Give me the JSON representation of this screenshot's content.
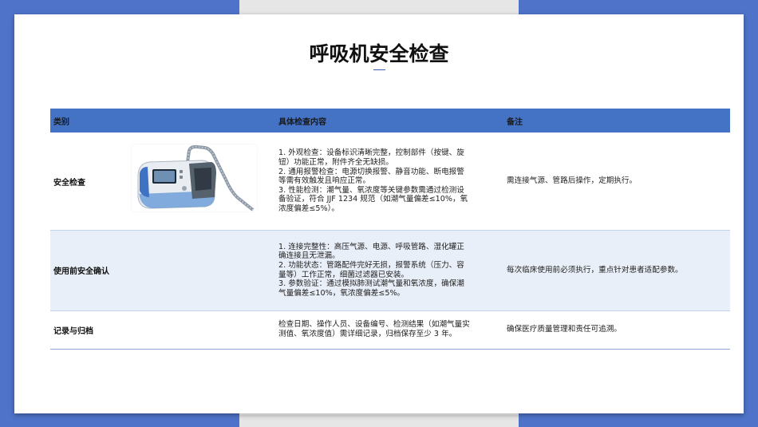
{
  "slide": {
    "title": "呼吸机安全检查"
  },
  "table": {
    "headers": [
      "类别",
      "具体检查内容",
      "备注"
    ],
    "rows": [
      {
        "category": "安全检查",
        "content": [
          "1. 外观检查：设备标识清晰完整，控制部件（按键、旋",
          "钮）功能正常，附件齐全无缺损。",
          "2. 通用报警检查：电源切换报警、静音功能、断电报警",
          "等需有效触发且响应正常。",
          "3. 性能检测：潮气量、氧浓度等关键参数需通过检测设",
          "备验证，符合 JJF 1234 规范（如潮气量偏差≤10%，氧",
          "浓度偏差≤5%）。"
        ],
        "note": "需连接气源、管路后操作，定期执行。"
      },
      {
        "category": "使用前安全确认",
        "content": [
          "1. 连接完整性：高压气源、电源、呼吸管路、湿化罐正",
          "确连接且无泄漏。",
          "2. 功能状态：管路配件完好无损，报警系统（压力、容",
          "量等）工作正常，细菌过滤器已安装。",
          "3. 参数验证：通过模拟肺测试潮气量和氧浓度，确保潮",
          "气量偏差≤10%，氧浓度偏差≤5%。"
        ],
        "note": "每次临床使用前必须执行，重点针对患者适配参数。"
      },
      {
        "category": "记录与归档",
        "content": [
          "检查日期、操作人员、设备编号、检测结果（如潮气量实",
          "测值、氧浓度值）需详细记录，归档保存至少 3 年。"
        ],
        "note": "确保医疗质量管理和责任可追溯。"
      }
    ]
  },
  "colors": {
    "side_blue": "#4f73c9",
    "header_blue": "#4472c4",
    "stripe": "#e9eff8"
  }
}
